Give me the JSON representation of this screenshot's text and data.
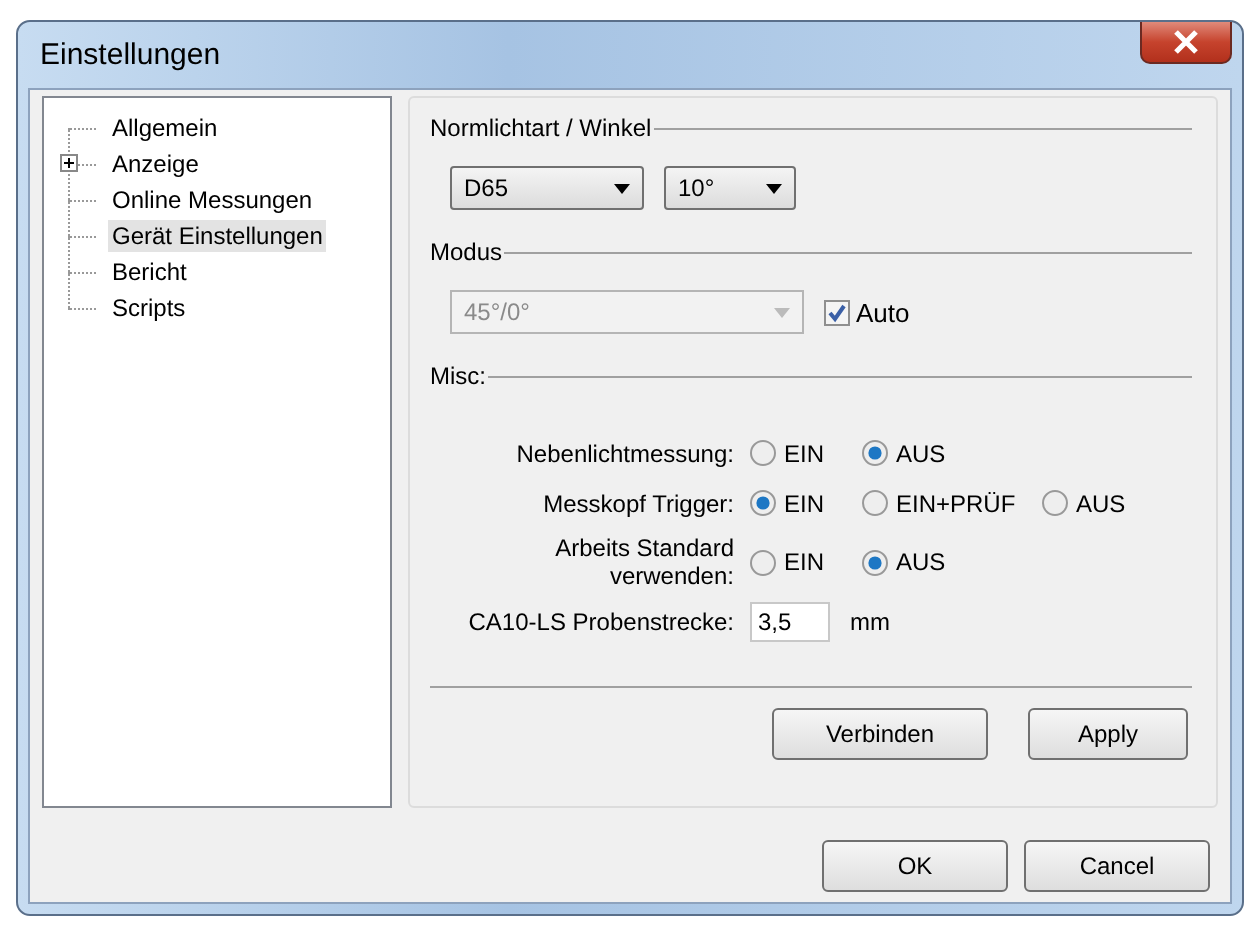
{
  "window": {
    "title": "Einstellungen"
  },
  "tree": [
    {
      "label": "Allgemein",
      "kind": "leaf",
      "selected": false
    },
    {
      "label": "Anzeige",
      "kind": "group",
      "expanded": false,
      "selected": false
    },
    {
      "label": "Online Messungen",
      "kind": "leaf",
      "selected": false
    },
    {
      "label": "Gerät Einstellungen",
      "kind": "leaf",
      "selected": true
    },
    {
      "label": "Bericht",
      "kind": "leaf",
      "selected": false
    },
    {
      "label": "Scripts",
      "kind": "leaf",
      "selected": false
    }
  ],
  "sections": [
    {
      "title": "Normlichtart / Winkel"
    },
    {
      "title": "Modus"
    },
    {
      "title": "Misc:"
    }
  ],
  "illuminant": {
    "value": "D65"
  },
  "angle": {
    "value": "10°"
  },
  "mode": {
    "value": "45°/0°",
    "disabled": true
  },
  "auto": {
    "label": "Auto",
    "checked": true
  },
  "radio_rows": [
    {
      "label": "Nebenlichtmessung:",
      "options": [
        {
          "label": "EIN",
          "selected": false
        },
        {
          "label": "AUS",
          "selected": true
        }
      ]
    },
    {
      "label": "Messkopf Trigger:",
      "options": [
        {
          "label": "EIN",
          "selected": true
        },
        {
          "label": "EIN+PRÜF",
          "selected": false
        },
        {
          "label": "AUS",
          "selected": false
        }
      ]
    },
    {
      "label": "Arbeits Standard verwenden:",
      "options": [
        {
          "label": "EIN",
          "selected": false
        },
        {
          "label": "AUS",
          "selected": true
        }
      ]
    }
  ],
  "sample_distance": {
    "label": "CA10-LS Probenstrecke:",
    "value": "3,5",
    "unit": "mm"
  },
  "panel_buttons": [
    "Verbinden",
    "Apply"
  ],
  "dialog_buttons": [
    "OK",
    "Cancel"
  ]
}
